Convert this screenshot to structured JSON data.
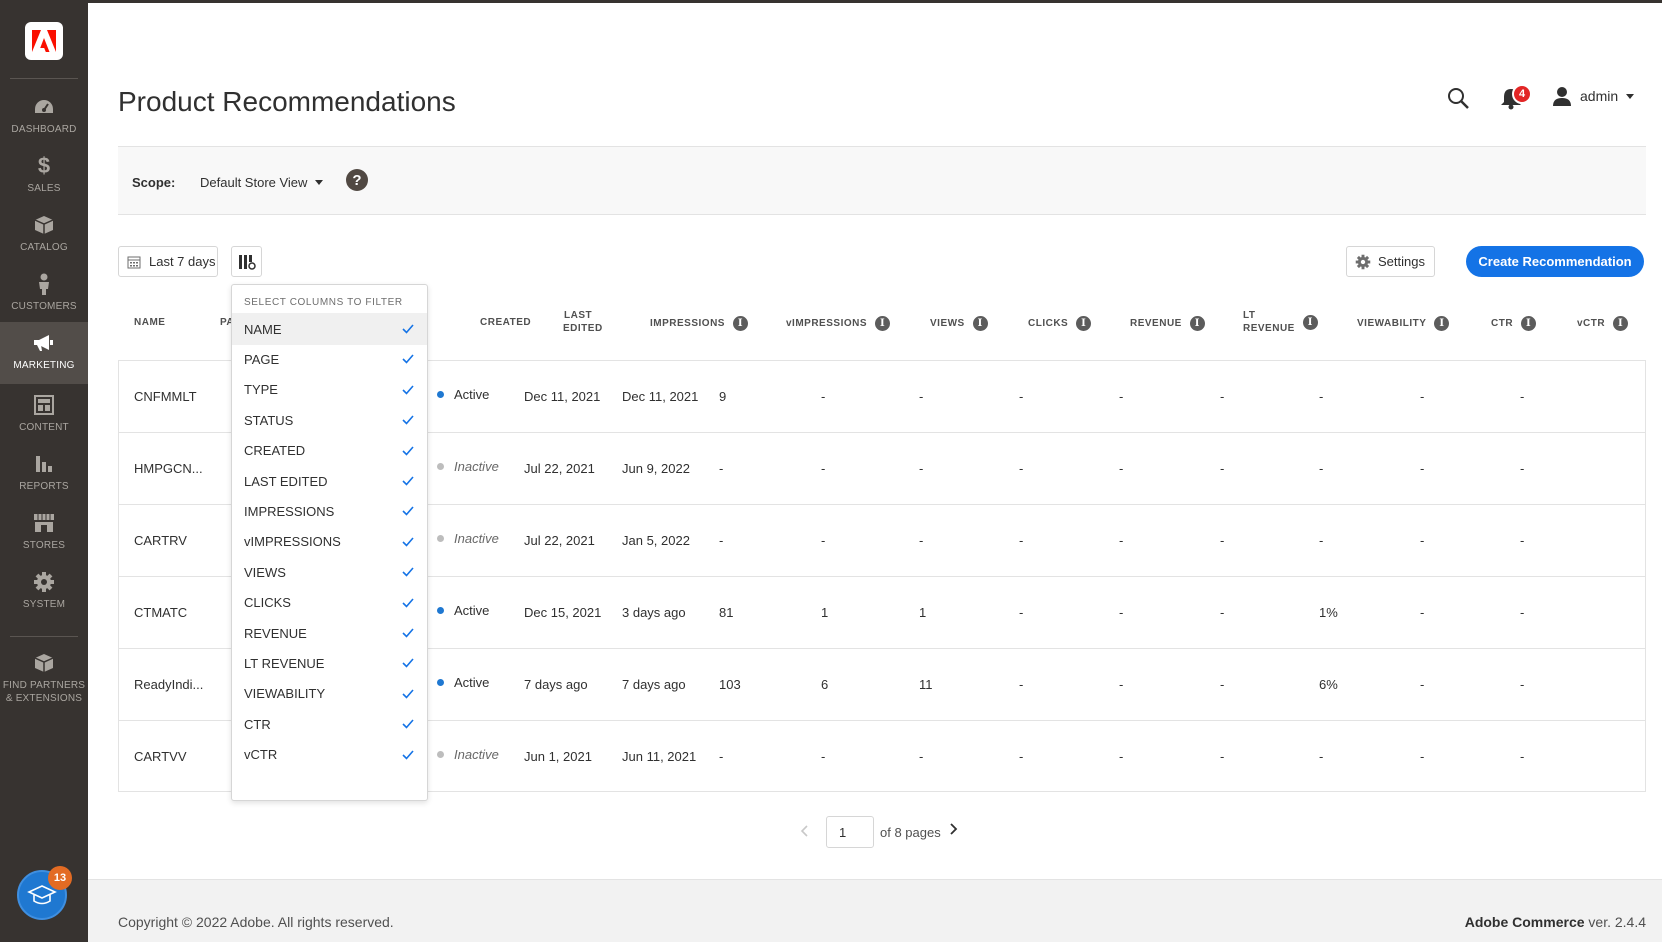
{
  "sidebar": {
    "items": [
      {
        "label": "DASHBOARD",
        "icon": "dashboard-icon"
      },
      {
        "label": "SALES",
        "icon": "dollar-icon"
      },
      {
        "label": "CATALOG",
        "icon": "box-icon"
      },
      {
        "label": "CUSTOMERS",
        "icon": "person-icon"
      },
      {
        "label": "MARKETING",
        "icon": "megaphone-icon",
        "active": true
      },
      {
        "label": "CONTENT",
        "icon": "layout-icon"
      },
      {
        "label": "REPORTS",
        "icon": "bar-chart-icon"
      },
      {
        "label": "STORES",
        "icon": "store-icon"
      },
      {
        "label": "SYSTEM",
        "icon": "gear-icon"
      },
      {
        "label": "FIND PARTNERS & EXTENSIONS",
        "icon": "extensions-icon"
      }
    ],
    "learn_badge": "13"
  },
  "header": {
    "title": "Product Recommendations",
    "notification_count": "4",
    "user": "admin"
  },
  "scope": {
    "label": "Scope:",
    "value": "Default Store View",
    "help": "?"
  },
  "toolbar": {
    "date_range": "Last 7 days",
    "settings": "Settings",
    "create": "Create Recommendation"
  },
  "table": {
    "headers": {
      "name": "NAME",
      "page": "PA",
      "created": "CREATED",
      "last_edited_1": "LAST",
      "last_edited_2": "EDITED",
      "impressions": "IMPRESSIONS",
      "vimpressions": "vIMPRESSIONS",
      "views": "VIEWS",
      "clicks": "CLICKS",
      "revenue": "REVENUE",
      "lt_revenue_1": "LT",
      "lt_revenue_2": "REVENUE",
      "viewability": "VIEWABILITY",
      "ctr": "CTR",
      "vctr": "vCTR"
    },
    "rows": [
      {
        "name": "CNFMMLT",
        "status": "Active",
        "created": "Dec 11, 2021",
        "edited": "Dec 11, 2021",
        "impressions": "9",
        "vimpressions": "-",
        "views": "-",
        "clicks": "-",
        "revenue": "-",
        "lt_revenue": "-",
        "viewability": "-",
        "ctr": "-",
        "vctr": "-"
      },
      {
        "name": "HMPGCN...",
        "status": "Inactive",
        "created": "Jul 22, 2021",
        "edited": "Jun 9, 2022",
        "impressions": "-",
        "vimpressions": "-",
        "views": "-",
        "clicks": "-",
        "revenue": "-",
        "lt_revenue": "-",
        "viewability": "-",
        "ctr": "-",
        "vctr": "-"
      },
      {
        "name": "CARTRV",
        "status": "Inactive",
        "created": "Jul 22, 2021",
        "edited": "Jan 5, 2022",
        "impressions": "-",
        "vimpressions": "-",
        "views": "-",
        "clicks": "-",
        "revenue": "-",
        "lt_revenue": "-",
        "viewability": "-",
        "ctr": "-",
        "vctr": "-"
      },
      {
        "name": "CTMATC",
        "status": "Active",
        "created": "Dec 15, 2021",
        "edited": "3 days ago",
        "impressions": "81",
        "vimpressions": "1",
        "views": "1",
        "clicks": "-",
        "revenue": "-",
        "lt_revenue": "-",
        "viewability": "1%",
        "ctr": "-",
        "vctr": "-"
      },
      {
        "name": "ReadyIndi...",
        "status": "Active",
        "created": "7 days ago",
        "edited": "7 days ago",
        "impressions": "103",
        "vimpressions": "6",
        "views": "11",
        "clicks": "-",
        "revenue": "-",
        "lt_revenue": "-",
        "viewability": "6%",
        "ctr": "-",
        "vctr": "-"
      },
      {
        "name": "CARTVV",
        "status": "Inactive",
        "created": "Jun 1, 2021",
        "edited": "Jun 11, 2021",
        "impressions": "-",
        "vimpressions": "-",
        "views": "-",
        "clicks": "-",
        "revenue": "-",
        "lt_revenue": "-",
        "viewability": "-",
        "ctr": "-",
        "vctr": "-"
      }
    ]
  },
  "column_filter": {
    "heading": "SELECT COLUMNS TO FILTER",
    "items": [
      "NAME",
      "PAGE",
      "TYPE",
      "STATUS",
      "CREATED",
      "LAST EDITED",
      "IMPRESSIONS",
      "vIMPRESSIONS",
      "VIEWS",
      "CLICKS",
      "REVENUE",
      "LT REVENUE",
      "VIEWABILITY",
      "CTR",
      "vCTR"
    ]
  },
  "pagination": {
    "current": "1",
    "total_text": "of 8 pages"
  },
  "footer": {
    "copyright": "Copyright © 2022 Adobe. All rights reserved.",
    "product": "Adobe Commerce",
    "version": " ver. 2.4.4"
  },
  "colors": {
    "sidebar": "#373330",
    "active_dot": "#1f78d1",
    "inactive_dot": "#bdbdbd",
    "primary": "#1473e6",
    "checkmark": "#1473e6"
  }
}
